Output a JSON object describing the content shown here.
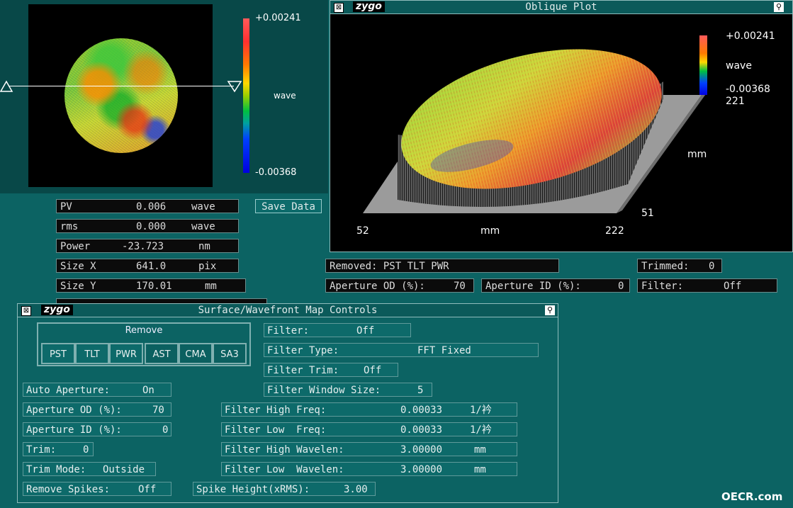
{
  "map_panel": {
    "scale_max": "+0.00241",
    "scale_min": "-0.00368",
    "scale_unit": "wave"
  },
  "results": {
    "pv": {
      "label": "PV",
      "value": "0.006",
      "unit": "wave"
    },
    "rms": {
      "label": "rms",
      "value": "0.000",
      "unit": "wave"
    },
    "power": {
      "label": "Power",
      "value": "-23.723",
      "unit": "nm"
    },
    "size_x": {
      "label": "Size X",
      "value": "641.0",
      "unit": "pix"
    },
    "size_y": {
      "label": "Size Y",
      "value": "170.01",
      "unit": "mm"
    },
    "save_label": "Save Data"
  },
  "oblique": {
    "logo": "zygo",
    "title": "Oblique Plot",
    "scale_max": "+0.00241",
    "scale_unit": "wave",
    "scale_min": "-0.00368",
    "scale_extra": "221",
    "axis_x_min": "52",
    "axis_x_unit": "mm",
    "axis_x_max": "222",
    "axis_y_unit": "mm",
    "axis_y_min": "51"
  },
  "status": {
    "removed": "Removed: PST TLT PWR",
    "trimmed_label": "Trimmed:",
    "trimmed_value": "0",
    "aperture_od_label": "Aperture OD (%):",
    "aperture_od_value": "70",
    "aperture_id_label": "Aperture ID (%):",
    "aperture_id_value": "0",
    "filter_label": "Filter:",
    "filter_value": "Off"
  },
  "controls": {
    "logo": "zygo",
    "title": "Surface/Wavefront Map Controls",
    "remove_title": "Remove",
    "remove_buttons": [
      "PST",
      "TLT",
      "PWR",
      "AST",
      "CMA",
      "SA3"
    ],
    "filter": {
      "label": "Filter:",
      "value": "Off"
    },
    "filter_type": {
      "label": "Filter Type:",
      "value": "FFT Fixed"
    },
    "filter_trim": {
      "label": "Filter Trim:",
      "value": "Off"
    },
    "filter_window": {
      "label": "Filter Window Size:",
      "value": "5"
    },
    "auto_aperture": {
      "label": "Auto Aperture:",
      "value": "On"
    },
    "aperture_od": {
      "label": "Aperture OD (%):",
      "value": "70"
    },
    "aperture_id": {
      "label": "Aperture ID (%):",
      "value": "0"
    },
    "trim": {
      "label": "Trim:",
      "value": "0"
    },
    "trim_mode": {
      "label": "Trim Mode:",
      "value": "Outside"
    },
    "remove_spikes": {
      "label": "Remove Spikes:",
      "value": "Off"
    },
    "high_freq": {
      "label": "Filter High Freq:",
      "value": "0.00033",
      "unit": "1/衿"
    },
    "low_freq": {
      "label": "Filter Low  Freq:",
      "value": "0.00033",
      "unit": "1/衿"
    },
    "high_wavelen": {
      "label": "Filter High Wavelen:",
      "value": "3.00000",
      "unit": "mm"
    },
    "low_wavelen": {
      "label": "Filter Low  Wavelen:",
      "value": "3.00000",
      "unit": "mm"
    },
    "spike_height": {
      "label": "Spike Height(xRMS):",
      "value": "3.00"
    }
  },
  "watermark": "OECR.com",
  "colors": {
    "background": "#0c6363",
    "scale_top": "#ff6060",
    "scale_bottom": "#0000ff"
  }
}
